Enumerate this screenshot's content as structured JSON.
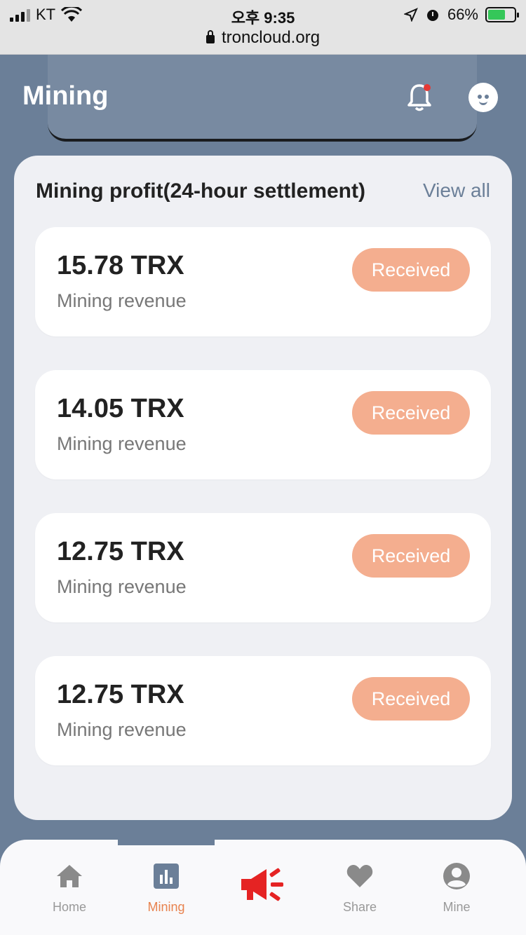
{
  "status_bar": {
    "carrier": "KT",
    "time": "오후 9:35",
    "battery": "66%",
    "url": "troncloud.org"
  },
  "header": {
    "title": "Mining"
  },
  "section": {
    "title": "Mining profit(24-hour settlement)",
    "view_all": "View all"
  },
  "records": [
    {
      "amount": "15.78 TRX",
      "label": "Mining revenue",
      "status": "Received"
    },
    {
      "amount": "14.05 TRX",
      "label": "Mining revenue",
      "status": "Received"
    },
    {
      "amount": "12.75 TRX",
      "label": "Mining revenue",
      "status": "Received"
    },
    {
      "amount": "12.75 TRX",
      "label": "Mining revenue",
      "status": "Received"
    }
  ],
  "tabs": [
    {
      "label": "Home",
      "icon": "home-icon"
    },
    {
      "label": "Mining",
      "icon": "chart-icon",
      "active": true
    },
    {
      "label": "",
      "icon": "megaphone-icon"
    },
    {
      "label": "Share",
      "icon": "heart-icon"
    },
    {
      "label": "Mine",
      "icon": "user-icon"
    }
  ],
  "colors": {
    "background": "#6b7f98",
    "badge": "#f4ae8f",
    "active_tab": "#e8834f",
    "megaphone": "#e52323"
  }
}
